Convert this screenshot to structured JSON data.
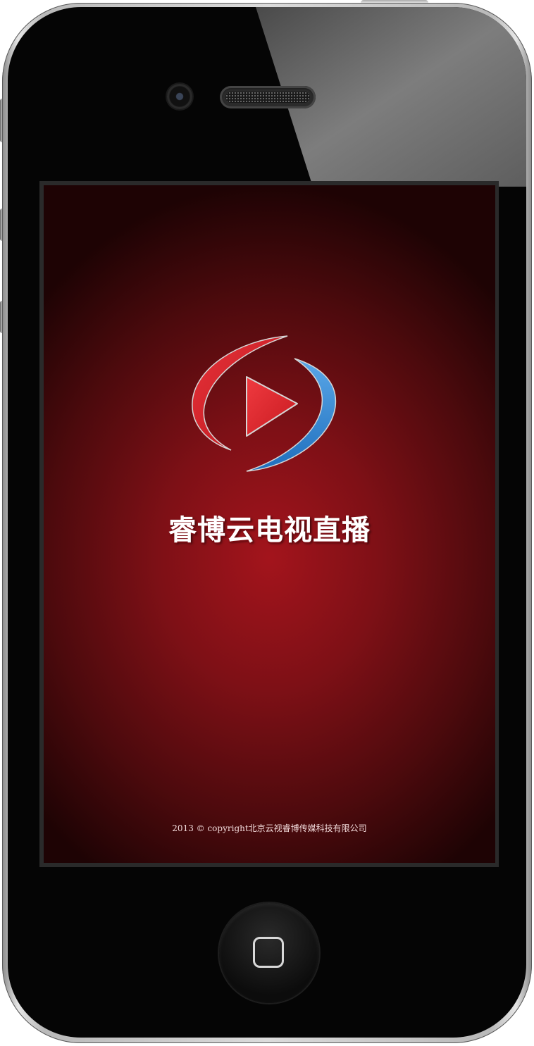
{
  "device": {
    "type": "phone-mockup",
    "screen": "splash-screen"
  },
  "splash": {
    "logo_icon": "play-logo-icon",
    "title": "睿博云电视直播",
    "copyright": "2013 © copyright北京云视睿博传媒科技有限公司"
  },
  "colors": {
    "background_center": "#a3141c",
    "background_edge": "#1e0304",
    "logo_red": "#e3262e",
    "logo_blue": "#2f86d4",
    "title_text": "#ffffff"
  }
}
